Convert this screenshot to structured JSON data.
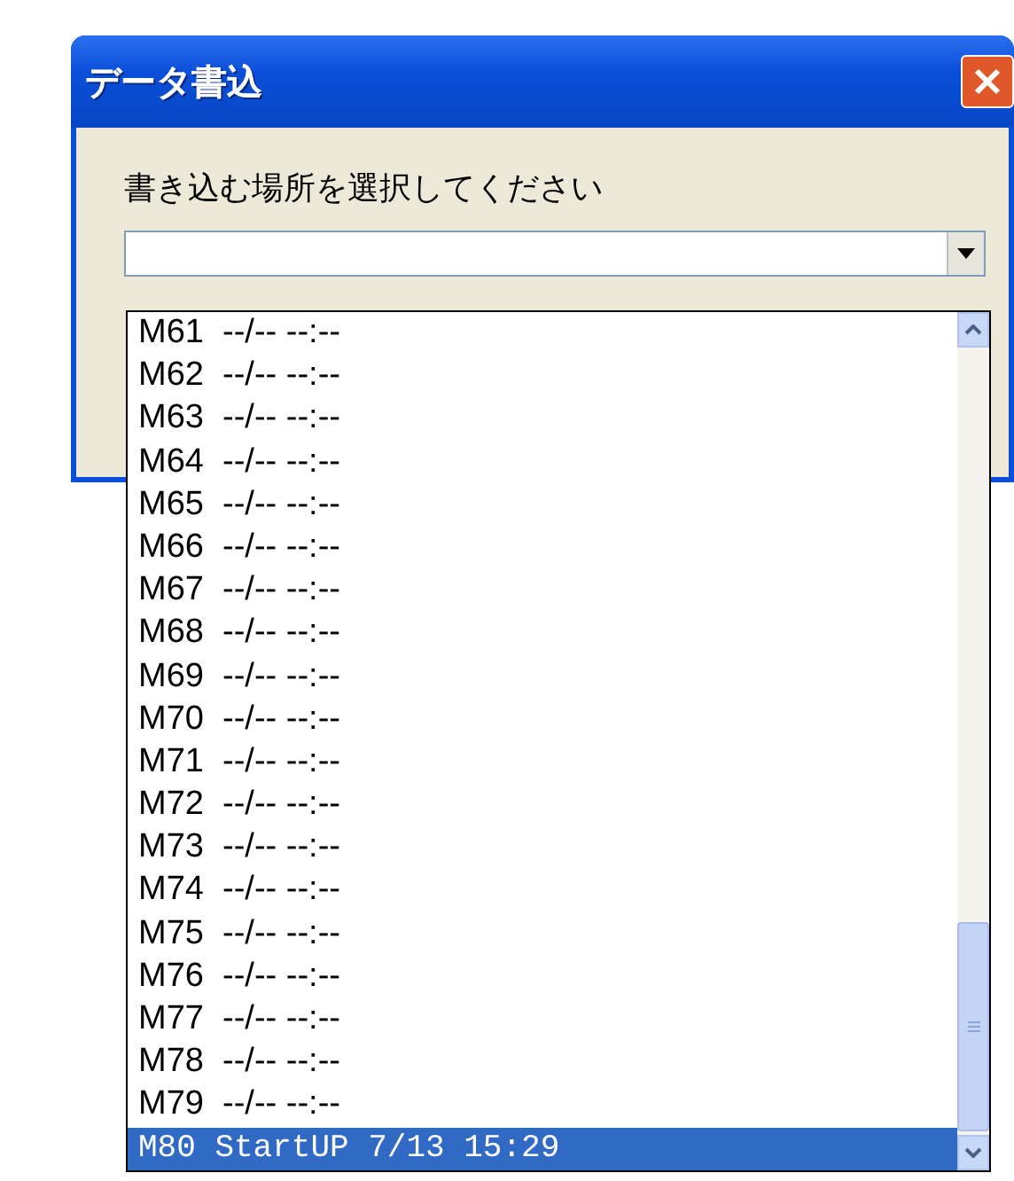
{
  "window": {
    "title": "データ書込"
  },
  "prompt": "書き込む場所を選択してください",
  "dropdown": {
    "expanded": true,
    "items": [
      {
        "text": "M61  --/-- --:--",
        "selected": false
      },
      {
        "text": "M62  --/-- --:--",
        "selected": false
      },
      {
        "text": "M63  --/-- --:--",
        "selected": false
      },
      {
        "text": "M64  --/-- --:--",
        "selected": false
      },
      {
        "text": "M65  --/-- --:--",
        "selected": false
      },
      {
        "text": "M66  --/-- --:--",
        "selected": false
      },
      {
        "text": "M67  --/-- --:--",
        "selected": false
      },
      {
        "text": "M68  --/-- --:--",
        "selected": false
      },
      {
        "text": "M69  --/-- --:--",
        "selected": false
      },
      {
        "text": "M70  --/-- --:--",
        "selected": false
      },
      {
        "text": "M71  --/-- --:--",
        "selected": false
      },
      {
        "text": "M72  --/-- --:--",
        "selected": false
      },
      {
        "text": "M73  --/-- --:--",
        "selected": false
      },
      {
        "text": "M74  --/-- --:--",
        "selected": false
      },
      {
        "text": "M75  --/-- --:--",
        "selected": false
      },
      {
        "text": "M76  --/-- --:--",
        "selected": false
      },
      {
        "text": "M77  --/-- --:--",
        "selected": false
      },
      {
        "text": "M78  --/-- --:--",
        "selected": false
      },
      {
        "text": "M79  --/-- --:--",
        "selected": false
      },
      {
        "text": "M80 StartUP 7/13 15:29",
        "selected": true
      }
    ]
  }
}
